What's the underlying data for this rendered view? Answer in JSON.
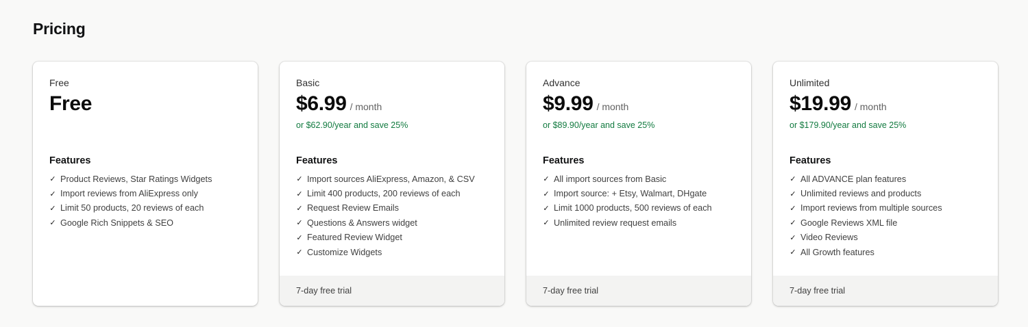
{
  "page": {
    "title": "Pricing"
  },
  "colors": {
    "accent_green": "#117a3f",
    "card_bg": "#ffffff",
    "footer_bg": "#f3f3f2"
  },
  "plans": [
    {
      "name": "Free",
      "price": "Free",
      "period": "",
      "yearly": "",
      "features_title": "Features",
      "features": [
        "Product Reviews, Star Ratings Widgets",
        "Import reviews from AliExpress only",
        "Limit 50 products, 20 reviews of each",
        "Google Rich Snippets & SEO"
      ],
      "footer": ""
    },
    {
      "name": "Basic",
      "price": "$6.99",
      "period": "/ month",
      "yearly": "or $62.90/year and save 25%",
      "features_title": "Features",
      "features": [
        "Import sources AliExpress, Amazon, & CSV",
        "Limit 400 products, 200 reviews of each",
        "Request Review Emails",
        "Questions & Answers widget",
        "Featured Review Widget",
        "Customize Widgets"
      ],
      "footer": "7-day free trial"
    },
    {
      "name": "Advance",
      "price": "$9.99",
      "period": "/ month",
      "yearly": "or $89.90/year and save 25%",
      "features_title": "Features",
      "features": [
        "All import sources from Basic",
        "Import source: + Etsy, Walmart, DHgate",
        "Limit 1000 products, 500 reviews of each",
        "Unlimited review request emails"
      ],
      "footer": "7-day free trial"
    },
    {
      "name": "Unlimited",
      "price": "$19.99",
      "period": "/ month",
      "yearly": "or $179.90/year and save 25%",
      "features_title": "Features",
      "features": [
        "All ADVANCE plan features",
        "Unlimited reviews and products",
        "Import reviews from multiple sources",
        "Google Reviews XML file",
        "Video Reviews",
        "All Growth features"
      ],
      "footer": "7-day free trial"
    }
  ]
}
